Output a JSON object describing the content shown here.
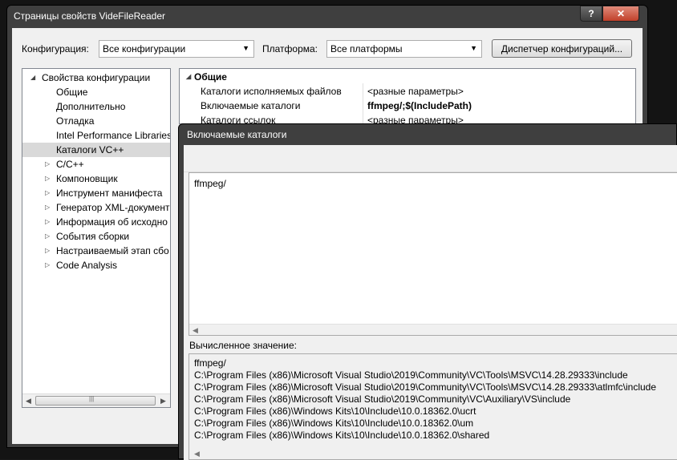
{
  "window": {
    "title": "Страницы свойств VideFileReader",
    "help": "?",
    "close": "✕"
  },
  "toolbar": {
    "config_label": "Конфигурация:",
    "config_value": "Все конфигурации",
    "platform_label": "Платформа:",
    "platform_value": "Все платформы",
    "config_manager": "Диспетчер конфигураций..."
  },
  "tree": {
    "root": "Свойства конфигурации",
    "items": [
      {
        "label": "Общие",
        "expandable": false
      },
      {
        "label": "Дополнительно",
        "expandable": false
      },
      {
        "label": "Отладка",
        "expandable": false
      },
      {
        "label": "Intel Performance Libraries",
        "expandable": false
      },
      {
        "label": "Каталоги VC++",
        "expandable": false,
        "selected": true
      },
      {
        "label": "C/C++",
        "expandable": true
      },
      {
        "label": "Компоновщик",
        "expandable": true
      },
      {
        "label": "Инструмент манифеста",
        "expandable": true
      },
      {
        "label": "Генератор XML-документ",
        "expandable": true
      },
      {
        "label": "Информация об исходно",
        "expandable": true
      },
      {
        "label": "События сборки",
        "expandable": true
      },
      {
        "label": "Настраиваемый этап сбо",
        "expandable": true
      },
      {
        "label": "Code Analysis",
        "expandable": true
      }
    ]
  },
  "grid": {
    "section": "Общие",
    "rows": [
      {
        "key": "Каталоги исполняемых файлов",
        "value": "<разные параметры>"
      },
      {
        "key": "Включаемые каталоги",
        "value": "ffmpeg/;$(IncludePath)"
      },
      {
        "key": "Каталоги ссылок",
        "value": "<разные параметры>"
      }
    ]
  },
  "dialog": {
    "title": "Включаемые каталоги",
    "edit_value": "ffmpeg/",
    "calc_label": "Вычисленное значение:",
    "calc_lines": [
      "ffmpeg/",
      "C:\\Program Files (x86)\\Microsoft Visual Studio\\2019\\Community\\VC\\Tools\\MSVC\\14.28.29333\\include",
      "C:\\Program Files (x86)\\Microsoft Visual Studio\\2019\\Community\\VC\\Tools\\MSVC\\14.28.29333\\atlmfc\\include",
      "C:\\Program Files (x86)\\Microsoft Visual Studio\\2019\\Community\\VC\\Auxiliary\\VS\\include",
      "C:\\Program Files (x86)\\Windows Kits\\10\\Include\\10.0.18362.0\\ucrt",
      "C:\\Program Files (x86)\\Windows Kits\\10\\Include\\10.0.18362.0\\um",
      "C:\\Program Files (x86)\\Windows Kits\\10\\Include\\10.0.18362.0\\shared"
    ]
  }
}
